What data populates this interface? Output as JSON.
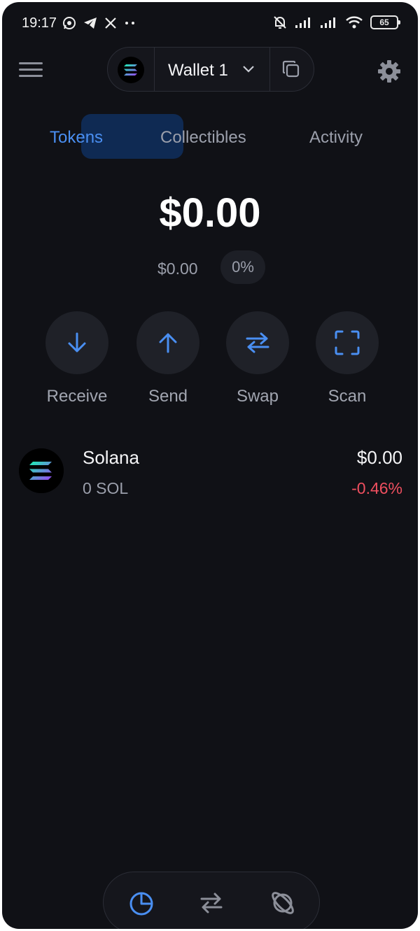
{
  "status_bar": {
    "time": "19:17",
    "battery": "65",
    "icons": [
      "whatsapp-icon",
      "telegram-icon",
      "x-icon",
      "more-dots-icon",
      "bell-off-icon",
      "signal-icon",
      "signal-icon",
      "wifi-icon",
      "battery-icon"
    ]
  },
  "header": {
    "wallet_name": "Wallet 1",
    "icons": [
      "menu-icon",
      "solana-logo",
      "chevron-down-icon",
      "copy-icon",
      "gear-icon"
    ]
  },
  "tabs": [
    {
      "label": "Tokens",
      "active": true
    },
    {
      "label": "Collectibles",
      "active": false
    },
    {
      "label": "Activity",
      "active": false
    }
  ],
  "portfolio": {
    "balance": "$0.00",
    "change_value": "$0.00",
    "change_percent": "0%"
  },
  "actions": [
    {
      "label": "Receive",
      "icon": "arrow-down-icon"
    },
    {
      "label": "Send",
      "icon": "arrow-up-icon"
    },
    {
      "label": "Swap",
      "icon": "swap-icon"
    },
    {
      "label": "Scan",
      "icon": "scan-icon"
    }
  ],
  "tokens": [
    {
      "name": "Solana",
      "amount": "0 SOL",
      "value": "$0.00",
      "change": "-0.46%"
    }
  ],
  "bottom_nav": [
    {
      "icon": "portfolio-pie-icon",
      "active": true
    },
    {
      "icon": "swap-icon",
      "active": false
    },
    {
      "icon": "explore-planet-icon",
      "active": false
    }
  ],
  "colors": {
    "background": "#101116",
    "accent": "#4a8ff2",
    "negative": "#ef4f5f",
    "muted_text": "#9b9fab"
  }
}
